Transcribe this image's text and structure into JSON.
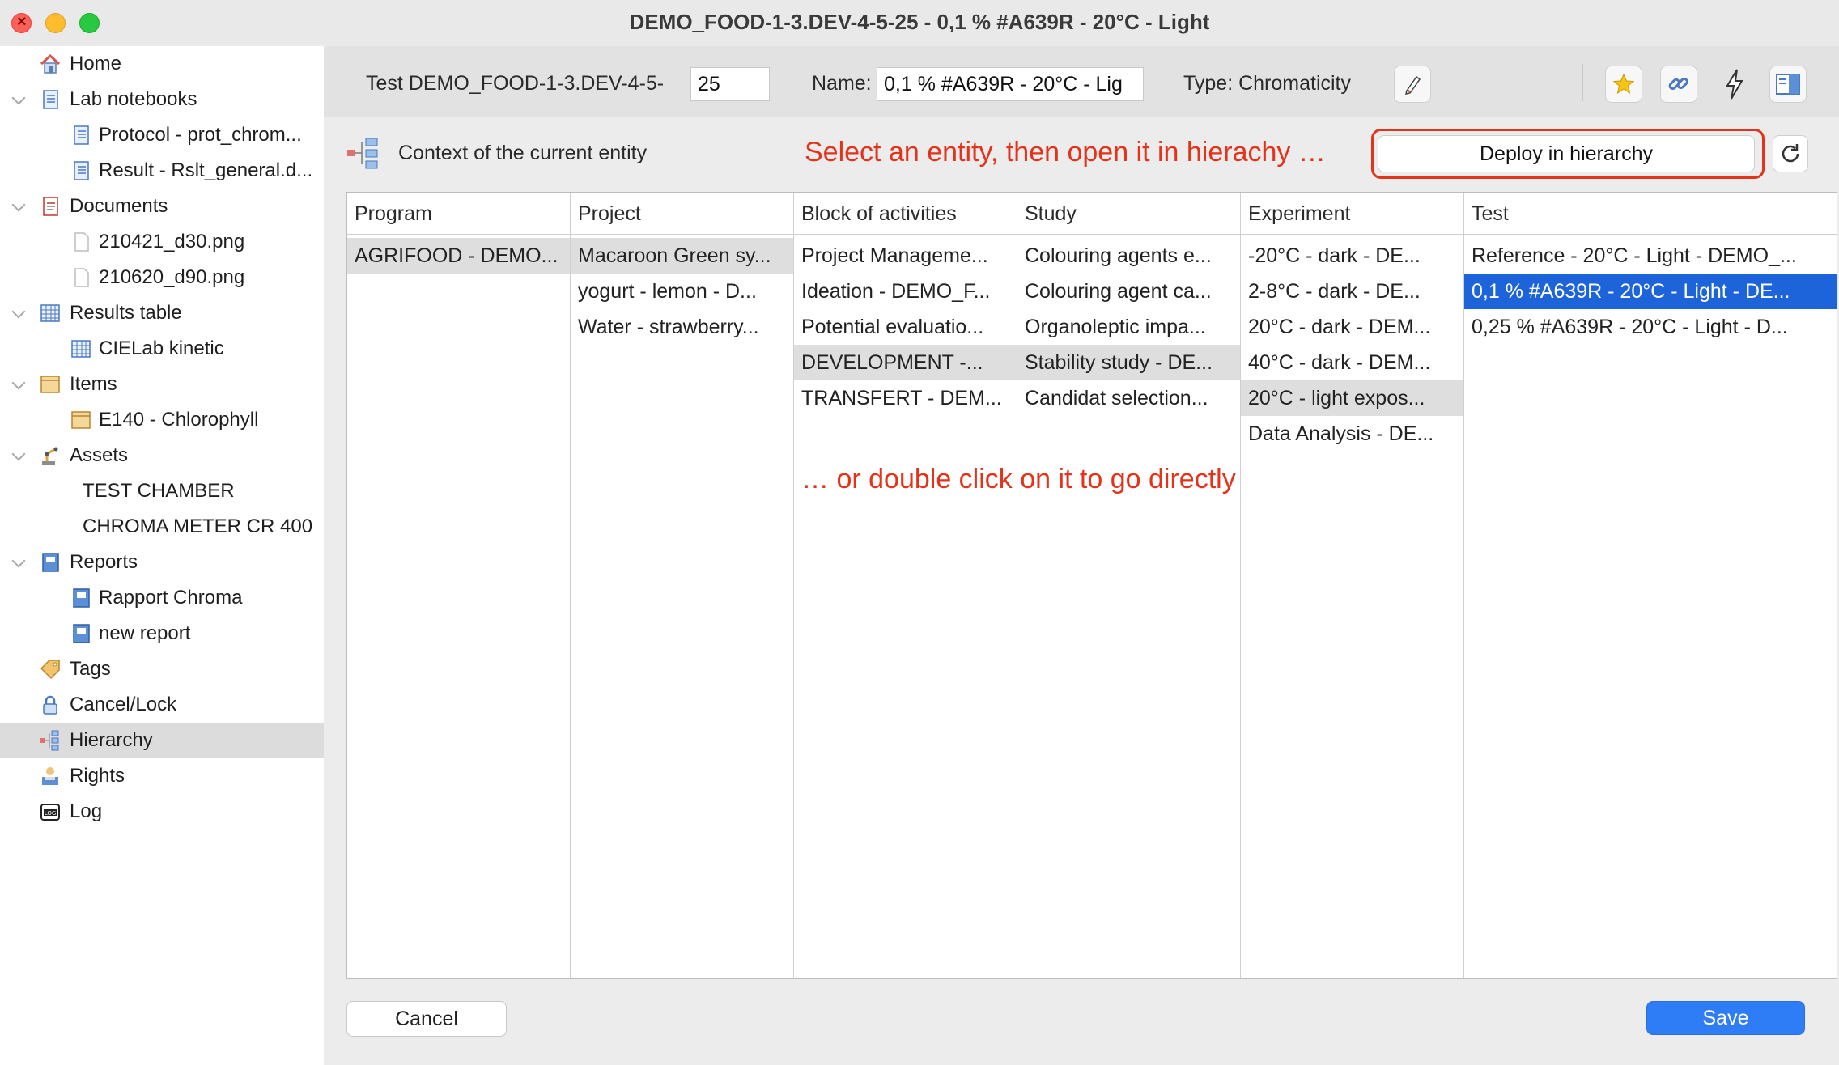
{
  "window": {
    "title": "DEMO_FOOD-1-3.DEV-4-5-25 - 0,1 % #A639R - 20°C - Light"
  },
  "sidebar": {
    "items": [
      {
        "label": "Home",
        "icon": "home-icon"
      },
      {
        "label": "Lab notebooks",
        "icon": "notebook-icon"
      },
      {
        "label": "Protocol - prot_chrom...",
        "icon": "notebook-page-icon"
      },
      {
        "label": "Result - Rslt_general.d...",
        "icon": "notebook-page-icon"
      },
      {
        "label": "Documents",
        "icon": "document-icon"
      },
      {
        "label": "210421_d30.png",
        "icon": "file-icon"
      },
      {
        "label": "210620_d90.png",
        "icon": "file-icon"
      },
      {
        "label": "Results table",
        "icon": "table-icon"
      },
      {
        "label": "CIELab kinetic",
        "icon": "table-icon"
      },
      {
        "label": "Items",
        "icon": "item-box-icon"
      },
      {
        "label": "E140 - Chlorophyll",
        "icon": "item-box-icon"
      },
      {
        "label": "Assets",
        "icon": "robot-arm-icon"
      },
      {
        "label": "TEST CHAMBER"
      },
      {
        "label": "CHROMA METER CR 400"
      },
      {
        "label": "Reports",
        "icon": "report-icon"
      },
      {
        "label": "Rapport Chroma",
        "icon": "report-icon"
      },
      {
        "label": "new report",
        "icon": "report-icon"
      },
      {
        "label": "Tags",
        "icon": "tag-icon"
      },
      {
        "label": "Cancel/Lock",
        "icon": "lock-icon"
      },
      {
        "label": "Hierarchy",
        "icon": "hierarchy-icon",
        "selected": true
      },
      {
        "label": "Rights",
        "icon": "rights-icon"
      },
      {
        "label": "Log",
        "icon": "log-icon"
      }
    ]
  },
  "header": {
    "test_label": "Test DEMO_FOOD-1-3.DEV-4-5-",
    "test_value": "25",
    "name_label": "Name:",
    "name_value": "0,1 % #A639R - 20°C - Lig",
    "type_label": "Type: Chromaticity"
  },
  "context": {
    "label": "Context of the current entity",
    "hint_top": "Select an entity, then open it in hierachy …",
    "deploy_label": "Deploy in hierarchy",
    "hint_middle": "… or double click on it to go directly"
  },
  "grid": {
    "columns": [
      {
        "header": "Program",
        "cells": [
          "AGRIFOOD - DEMO..."
        ],
        "gray": [
          0
        ]
      },
      {
        "header": "Project",
        "cells": [
          "Macaroon Green sy...",
          "yogurt - lemon - D...",
          "Water - strawberry..."
        ],
        "gray": [
          0
        ]
      },
      {
        "header": "Block of activities",
        "cells": [
          "Project Manageme...",
          "Ideation - DEMO_F...",
          "Potential evaluatio...",
          "DEVELOPMENT -...",
          "TRANSFERT - DEM..."
        ],
        "gray": [
          3
        ]
      },
      {
        "header": "Study",
        "cells": [
          "Colouring agents e...",
          "Colouring agent ca...",
          "Organoleptic impa...",
          "Stability study - DE...",
          "Candidat selection..."
        ],
        "gray": [
          3
        ]
      },
      {
        "header": "Experiment",
        "cells": [
          "-20°C - dark - DE...",
          "2-8°C - dark - DE...",
          "20°C - dark - DEM...",
          "40°C - dark - DEM...",
          "20°C - light expos...",
          "Data Analysis - DE..."
        ],
        "gray": [
          4
        ]
      },
      {
        "header": "Test",
        "cells": [
          "Reference - 20°C - Light - DEMO_...",
          "0,1 % #A639R - 20°C - Light - DE...",
          "0,25 % #A639R - 20°C - Light - D..."
        ],
        "blue": [
          1
        ]
      }
    ]
  },
  "footer": {
    "cancel_label": "Cancel",
    "save_label": "Save"
  },
  "colors": {
    "accent": "#2f7df6",
    "selection": "#1d63d9",
    "annotation": "#e3331b"
  }
}
